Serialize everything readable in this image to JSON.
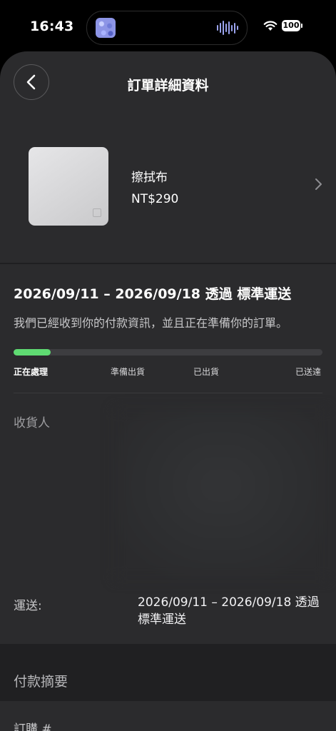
{
  "status_bar": {
    "time": "16:43",
    "battery": "100"
  },
  "header": {
    "title": "訂單詳細資料"
  },
  "product": {
    "name": "擦拭布",
    "price": "NT$290"
  },
  "shipment": {
    "title": "2026/09/11 – 2026/09/18 透過 標準運送",
    "description": "我們已經收到你的付款資訊，並且正在準備你的訂單。",
    "progress": 0.12,
    "accent_color": "#5fdb72",
    "steps": [
      "正在處理",
      "準備出貨",
      "已出貨",
      "已送達"
    ]
  },
  "details": {
    "recipient_label": "收貨人",
    "shipping_label": "運送:",
    "shipping_value": "2026/09/11 – 2026/09/18 透過 標準運送"
  },
  "payment": {
    "summary_label": "付款摘要",
    "order_label": "訂購 #"
  },
  "icons": {
    "back": "chevron-left-icon",
    "product_link": "chevron-right-icon",
    "wifi": "wifi-icon",
    "battery": "battery-icon"
  }
}
